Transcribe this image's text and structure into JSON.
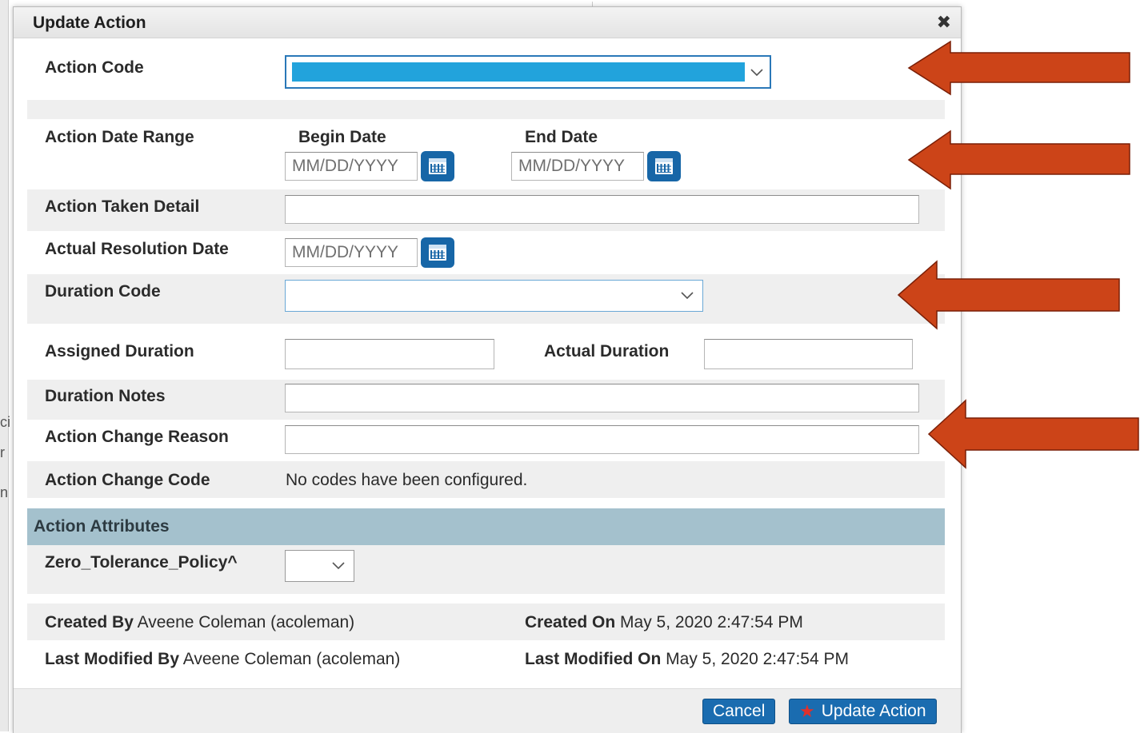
{
  "dialog": {
    "title": "Update Action",
    "close_glyph": "✖"
  },
  "fields": {
    "action_code": {
      "label": "Action Code"
    },
    "date_range": {
      "label": "Action Date Range",
      "begin_label": "Begin Date",
      "end_label": "End Date",
      "begin_placeholder": "MM/DD/YYYY",
      "end_placeholder": "MM/DD/YYYY"
    },
    "taken_detail": {
      "label": "Action Taken Detail"
    },
    "resolution_date": {
      "label": "Actual Resolution Date",
      "placeholder": "MM/DD/YYYY"
    },
    "duration_code": {
      "label": "Duration Code"
    },
    "assigned_duration": {
      "label": "Assigned Duration"
    },
    "actual_duration": {
      "label": "Actual Duration"
    },
    "duration_notes": {
      "label": "Duration Notes"
    },
    "change_reason": {
      "label": "Action Change Reason"
    },
    "change_code": {
      "label": "Action Change Code",
      "value": "No codes have been configured."
    }
  },
  "attributes": {
    "header": "Action Attributes",
    "zero_tolerance_label": "Zero_Tolerance_Policy^"
  },
  "meta": {
    "created_by_label": "Created By",
    "created_by_value": "Aveene Coleman (acoleman)",
    "created_on_label": "Created On",
    "created_on_value": "May 5, 2020 2:47:54 PM",
    "modified_by_label": "Last Modified By",
    "modified_by_value": "Aveene Coleman (acoleman)",
    "modified_on_label": "Last Modified On",
    "modified_on_value": "May 5, 2020 2:47:54 PM"
  },
  "buttons": {
    "cancel": "Cancel",
    "update": "Update Action"
  },
  "colors": {
    "accent_blue": "#1a6cb0",
    "selection_highlight": "#22a3dc",
    "section_header": "#a4c1cd",
    "annotation_arrow": "#cc4418"
  },
  "icons": [
    "close-icon",
    "calendar-icon",
    "chevron-down-icon",
    "star-icon",
    "arrow-left-icon"
  ]
}
